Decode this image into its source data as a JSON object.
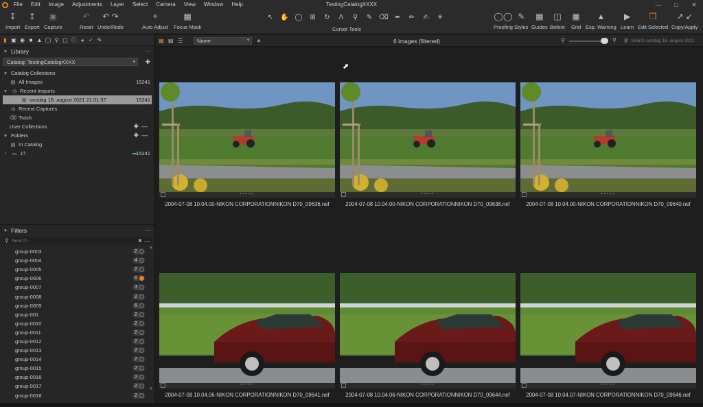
{
  "window": {
    "title": "TestingCatalogXXXX"
  },
  "menu": [
    "File",
    "Edit",
    "Image",
    "Adjustments",
    "Layer",
    "Select",
    "Camera",
    "View",
    "Window",
    "Help"
  ],
  "toolbar": {
    "left": [
      {
        "label": "Import",
        "icon": "import-icon"
      },
      {
        "label": "Export",
        "icon": "export-icon"
      },
      {
        "label": "Capture",
        "icon": "camera-icon"
      },
      {
        "label": "Reset",
        "icon": "reset-icon"
      },
      {
        "label": "Undo/Redo",
        "icon": "undo-icon"
      },
      {
        "label": "Auto Adjust",
        "icon": "wand-icon"
      },
      {
        "label": "Focus Mask",
        "icon": "focus-mask-icon"
      }
    ],
    "cursor_tools_label": "Cursor Tools",
    "right": [
      {
        "label": "Proofing",
        "icon": "glasses-icon"
      },
      {
        "label": "Styles",
        "icon": "brush-icon"
      },
      {
        "label": "Guides",
        "icon": "grid-guides-icon"
      },
      {
        "label": "Before",
        "icon": "before-icon"
      },
      {
        "label": "Grid",
        "icon": "grid-icon"
      },
      {
        "label": "Exp. Warning",
        "icon": "warning-icon"
      },
      {
        "label": "Learn",
        "icon": "video-icon"
      },
      {
        "label": "Edit Selected",
        "icon": "edit-selected-icon"
      },
      {
        "label": "Copy/Apply",
        "icon": "copy-apply-icon"
      }
    ]
  },
  "library": {
    "title": "Library",
    "catalog_select": "Catalog: TestingCatalogXXXX",
    "catalog_collections": "Catalog Collections",
    "all_images": {
      "label": "All Images",
      "count": "15241"
    },
    "recent_imports": "Recent Imports",
    "import_session": {
      "label": "onsdag 18. august 2021 21.01.57",
      "count": "15241"
    },
    "recent_captures": "Recent Captures",
    "trash": "Trash",
    "user_collections": "User Collections",
    "folders": "Folders",
    "in_catalog": "In Catalog",
    "drive": {
      "label": "J:\\",
      "count": "15241"
    }
  },
  "filters": {
    "title": "Filters",
    "search_placeholder": "Search",
    "groups": [
      {
        "name": "group-0003",
        "count": "2",
        "on": false
      },
      {
        "name": "group-0004",
        "count": "4",
        "on": false
      },
      {
        "name": "group-0005",
        "count": "2",
        "on": false
      },
      {
        "name": "group-0006",
        "count": "6",
        "on": true
      },
      {
        "name": "group-0007",
        "count": "3",
        "on": false
      },
      {
        "name": "group-0008",
        "count": "2",
        "on": false
      },
      {
        "name": "group-0009",
        "count": "6",
        "on": false
      },
      {
        "name": "group-001",
        "count": "2",
        "on": false
      },
      {
        "name": "group-0010",
        "count": "2",
        "on": false
      },
      {
        "name": "group-0011",
        "count": "2",
        "on": false
      },
      {
        "name": "group-0012",
        "count": "2",
        "on": false
      },
      {
        "name": "group-0013",
        "count": "2",
        "on": false
      },
      {
        "name": "group-0014",
        "count": "2",
        "on": false
      },
      {
        "name": "group-0015",
        "count": "2",
        "on": false
      },
      {
        "name": "group-0016",
        "count": "2",
        "on": false
      },
      {
        "name": "group-0017",
        "count": "2",
        "on": false
      },
      {
        "name": "group-0018",
        "count": "2",
        "on": false
      }
    ]
  },
  "viewer": {
    "sort": "Name",
    "image_count": "6 images (filtered)",
    "search_placeholder": "Search onsdag 18. august 2021",
    "images": [
      {
        "caption": "2004-07-08 10.04.00-NIKON CORPORATIONNIKON D70_09636.nef",
        "scene": "tractor"
      },
      {
        "caption": "2004-07-08 10.04.00-NIKON CORPORATIONNIKON D70_09638.nef",
        "scene": "tractor"
      },
      {
        "caption": "2004-07-08 10.04.00-NIKON CORPORATIONNIKON D70_09640.nef",
        "scene": "tractor"
      },
      {
        "caption": "2004-07-08 10.04.06-NIKON CORPORATIONNIKON D70_09641.nef",
        "scene": "car"
      },
      {
        "caption": "2004-07-08 10.04.06-NIKON CORPORATIONNIKON D70_09644.nef",
        "scene": "car"
      },
      {
        "caption": "2004-07-08 10.04.07-NIKON CORPORATIONNIKON D70_09646.nef",
        "scene": "car"
      }
    ]
  },
  "colors": {
    "accent": "#e8822b",
    "panel": "#262626",
    "viewer": "#1e1e1e",
    "drive_indicator": "#3cc24a"
  }
}
